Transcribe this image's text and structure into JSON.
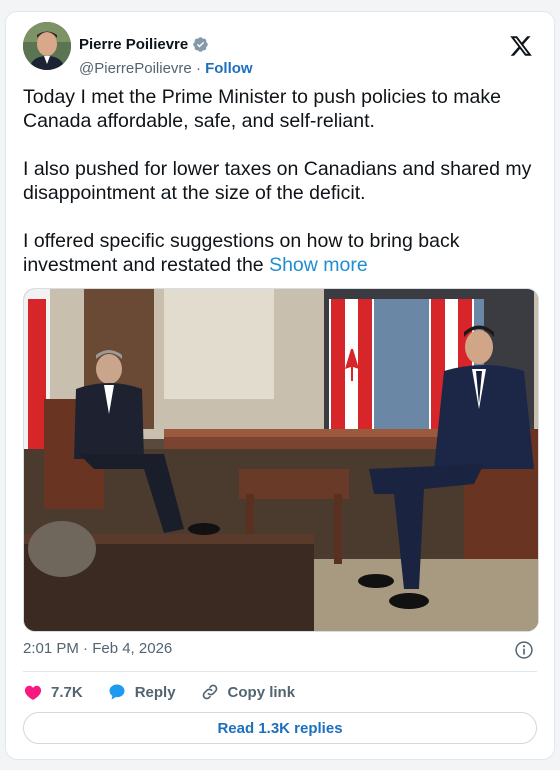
{
  "author": {
    "name": "Pierre Poilievre",
    "handle": "@PierrePoilievre",
    "separator": "·",
    "follow_label": "Follow"
  },
  "post": {
    "paragraphs": [
      "Today I met the Prime Minister to push policies to make Canada affordable, safe, and self-reliant.",
      "I also pushed for lower taxes on Canadians and shared my disappointment at the size of the deficit."
    ],
    "truncated_paragraph": "I offered specific suggestions on how to bring back investment and restated the",
    "show_more_label": "Show more"
  },
  "meta": {
    "timestamp": "2:01 PM · Feb 4, 2026"
  },
  "actions": {
    "likes_count": "7.7K",
    "reply_label": "Reply",
    "copy_link_label": "Copy link"
  },
  "read_replies_label": "Read 1.3K replies",
  "colors": {
    "accent": "#1d9bf0",
    "link": "#1d6fbf",
    "like": "#f91880",
    "verified": "#829aab"
  },
  "icons": [
    "verified-badge-icon",
    "x-logo-icon",
    "info-icon",
    "heart-icon",
    "reply-bubble-icon",
    "link-icon"
  ]
}
